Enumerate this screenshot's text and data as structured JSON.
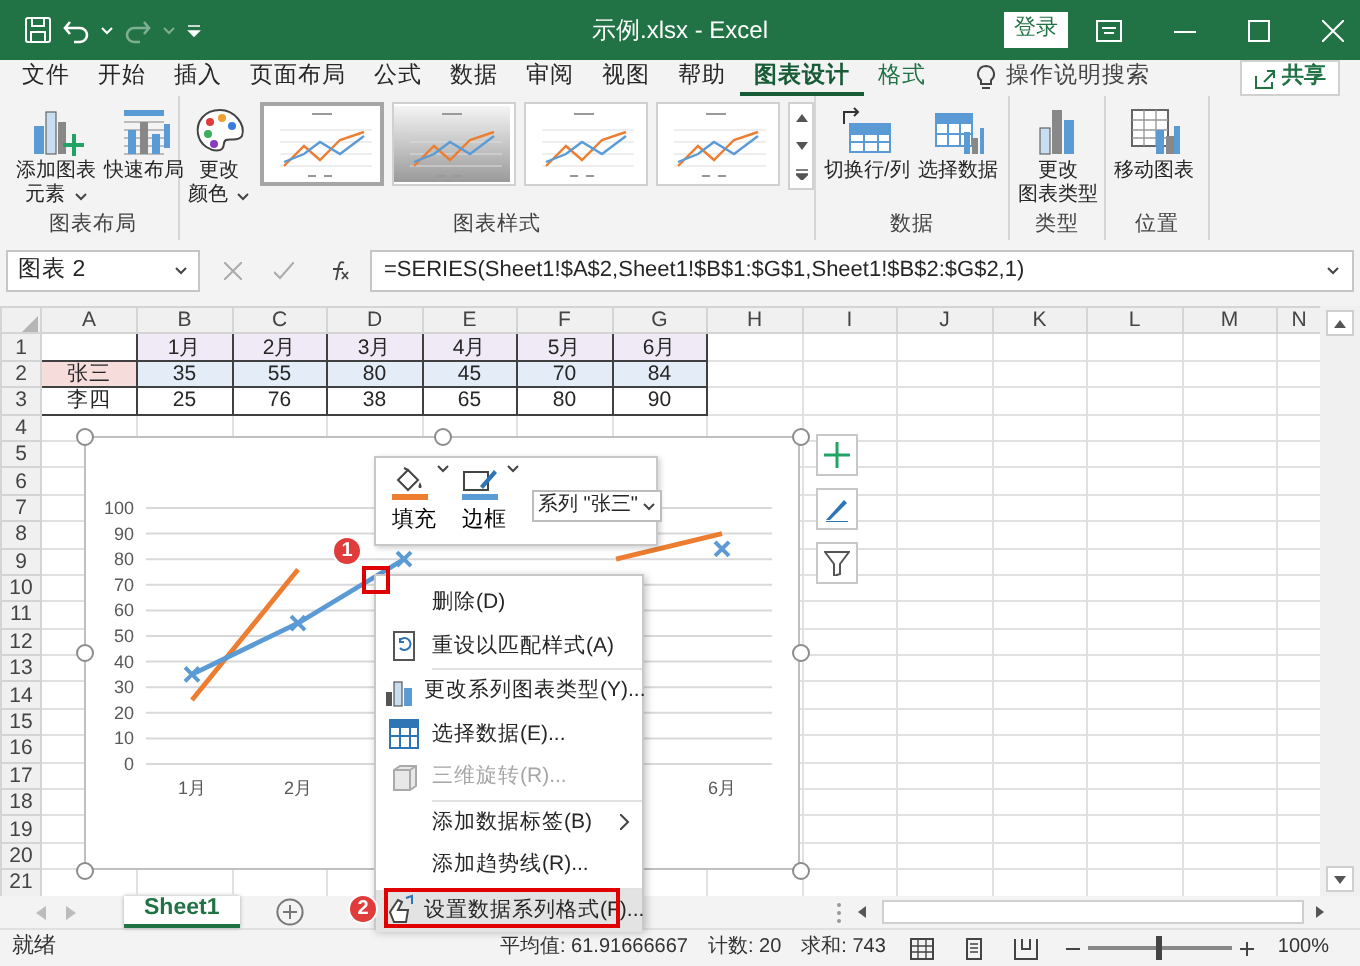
{
  "window": {
    "title": "示例.xlsx  -  Excel",
    "sign_in": "登录"
  },
  "tabs": [
    {
      "label": "文件",
      "selected": false,
      "kind": "normal"
    },
    {
      "label": "开始",
      "selected": false,
      "kind": "normal"
    },
    {
      "label": "插入",
      "selected": false,
      "kind": "normal"
    },
    {
      "label": "页面布局",
      "selected": false,
      "kind": "normal"
    },
    {
      "label": "公式",
      "selected": false,
      "kind": "normal"
    },
    {
      "label": "数据",
      "selected": false,
      "kind": "normal"
    },
    {
      "label": "审阅",
      "selected": false,
      "kind": "normal"
    },
    {
      "label": "视图",
      "selected": false,
      "kind": "normal"
    },
    {
      "label": "帮助",
      "selected": false,
      "kind": "normal"
    },
    {
      "label": "图表设计",
      "selected": true,
      "kind": "contextual"
    },
    {
      "label": "格式",
      "selected": false,
      "kind": "contextual"
    }
  ],
  "tell_me": "操作说明搜索",
  "share": "共享",
  "ribbon": [
    {
      "label": "图表布局",
      "buttons": [
        {
          "lines": [
            "添加图表",
            "元素"
          ],
          "dropdown": true
        },
        {
          "lines": [
            "快速布局"
          ],
          "dropdown": false
        }
      ]
    },
    {
      "label": "图表样式",
      "buttons": [
        {
          "lines": [
            "更改",
            "颜色"
          ],
          "dropdown": true
        }
      ],
      "gallery": [
        {
          "selected": true,
          "kind": "plain"
        },
        {
          "selected": false,
          "kind": "shaded"
        },
        {
          "selected": false,
          "kind": "plain"
        },
        {
          "selected": false,
          "kind": "plain"
        }
      ]
    },
    {
      "label": "数据",
      "buttons": [
        {
          "lines": [
            "切换行/列"
          ],
          "dropdown": false
        },
        {
          "lines": [
            "选择数据"
          ],
          "dropdown": false
        }
      ]
    },
    {
      "label": "类型",
      "buttons": [
        {
          "lines": [
            "更改",
            "图表类型"
          ],
          "dropdown": false
        }
      ]
    },
    {
      "label": "位置",
      "buttons": [
        {
          "lines": [
            "移动图表"
          ],
          "dropdown": false
        }
      ]
    }
  ],
  "formula_bar": {
    "name_box": "图表 2",
    "formula": "=SERIES(Sheet1!$A$2,Sheet1!$B$1:$G$1,Sheet1!$B$2:$G$2,1)"
  },
  "sheet": {
    "columns": [
      "A",
      "B",
      "C",
      "D",
      "E",
      "F",
      "G",
      "H",
      "I",
      "J",
      "K",
      "L",
      "M",
      "N"
    ],
    "rows": [
      {
        "number": "1",
        "cells": [
          null,
          {
            "text": "1月",
            "color": "#efeaf5"
          },
          {
            "text": "2月",
            "color": "#efeaf5"
          },
          {
            "text": "3月",
            "color": "#efeaf5"
          },
          {
            "text": "4月",
            "color": "#efeaf5"
          },
          {
            "text": "5月",
            "color": "#efeaf5"
          },
          {
            "text": "6月",
            "color": "#efeaf5"
          }
        ]
      },
      {
        "number": "2",
        "cells": [
          {
            "text": "张三",
            "color": "#f7dcdc"
          },
          {
            "text": "35",
            "color": "#e4ecf7"
          },
          {
            "text": "55",
            "color": "#e4ecf7"
          },
          {
            "text": "80",
            "color": "#e4ecf7"
          },
          {
            "text": "45",
            "color": "#e4ecf7"
          },
          {
            "text": "70",
            "color": "#e4ecf7"
          },
          {
            "text": "84",
            "color": "#e4ecf7"
          }
        ]
      },
      {
        "number": "3",
        "cells": [
          {
            "text": "李四"
          },
          {
            "text": "25"
          },
          {
            "text": "76"
          },
          {
            "text": "38"
          },
          {
            "text": "65"
          },
          {
            "text": "80"
          },
          {
            "text": "90"
          }
        ]
      },
      {
        "number": "4"
      },
      {
        "number": "5"
      },
      {
        "number": "6"
      },
      {
        "number": "7"
      },
      {
        "number": "8"
      },
      {
        "number": "9"
      },
      {
        "number": "10"
      },
      {
        "number": "11"
      },
      {
        "number": "12"
      },
      {
        "number": "13"
      },
      {
        "number": "14"
      },
      {
        "number": "15"
      },
      {
        "number": "16"
      },
      {
        "number": "17"
      },
      {
        "number": "18"
      },
      {
        "number": "19"
      },
      {
        "number": "20"
      },
      {
        "number": "21"
      }
    ]
  },
  "chart": {
    "chart_data": {
      "type": "line",
      "categories": [
        "1月",
        "2月",
        null,
        null,
        null,
        "6月"
      ],
      "ylim": [
        0,
        100
      ],
      "yticks": [
        0,
        10,
        20,
        30,
        40,
        50,
        60,
        70,
        80,
        90,
        100
      ],
      "grid": true,
      "series": [
        {
          "color": "#5b9bd5",
          "marker": "cross",
          "values": [
            35,
            55,
            80,
            null,
            null,
            84
          ]
        },
        {
          "color": "#ed7d31",
          "values": [
            25,
            76,
            null,
            null,
            80,
            90
          ]
        }
      ]
    }
  },
  "mini_toolbar": {
    "fill": "填充",
    "border": "边框",
    "series": "系列 \"张三\""
  },
  "context_menu": [
    {
      "label": "删除(D)",
      "disabled": false,
      "selected": false,
      "separator_before": false,
      "submenu": false
    },
    {
      "label": "重设以匹配样式(A)",
      "disabled": false,
      "selected": false,
      "separator_before": false,
      "submenu": false
    },
    {
      "label": "更改系列图表类型(Y)...",
      "disabled": false,
      "selected": false,
      "separator_before": true,
      "submenu": false
    },
    {
      "label": "选择数据(E)...",
      "disabled": false,
      "selected": false,
      "separator_before": false,
      "submenu": false
    },
    {
      "label": "三维旋转(R)...",
      "disabled": true,
      "selected": false,
      "separator_before": false,
      "submenu": false
    },
    {
      "label": "添加数据标签(B)",
      "disabled": false,
      "selected": false,
      "separator_before": true,
      "submenu": true
    },
    {
      "label": "添加趋势线(R)...",
      "disabled": false,
      "selected": false,
      "separator_before": false,
      "submenu": false
    },
    {
      "label": "设置数据系列格式(F)...",
      "disabled": false,
      "selected": true,
      "separator_before": true,
      "submenu": false
    }
  ],
  "annotations": [
    {
      "label": "1"
    },
    {
      "label": "2"
    }
  ],
  "sheet_tabs": [
    {
      "label": "Sheet1",
      "selected": true
    }
  ],
  "status_bar": {
    "ready": "就绪",
    "average": "平均值: 61.91666667",
    "count": "计数: 20",
    "sum": "求和: 743",
    "zoom": "100%",
    "zoom_slider": {
      "level": 0.5
    }
  }
}
